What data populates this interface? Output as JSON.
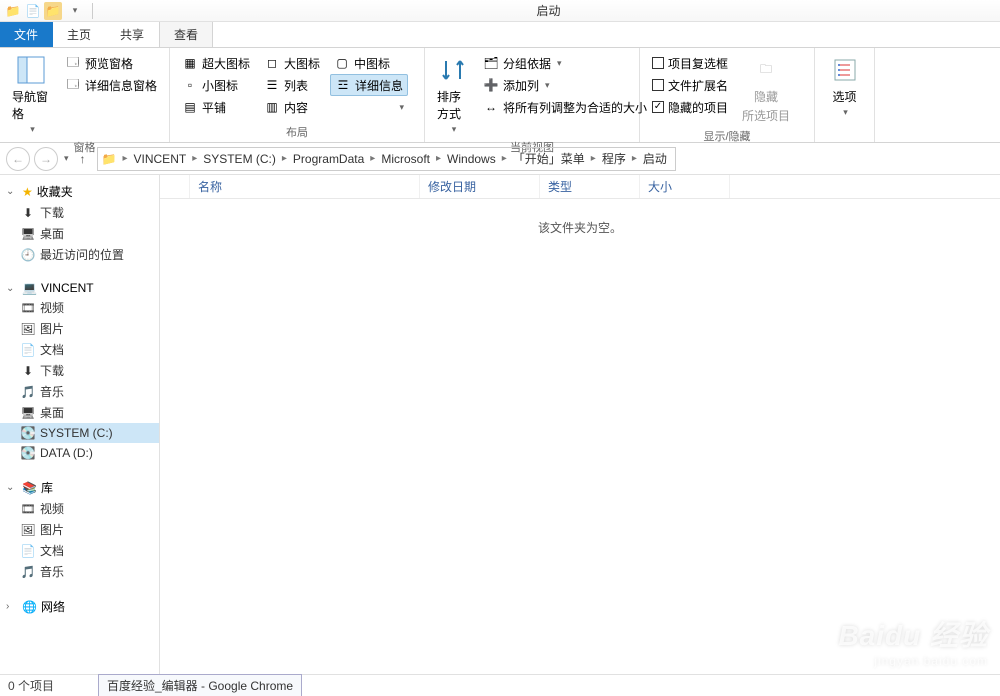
{
  "window": {
    "title": "启动"
  },
  "tabs": {
    "file": "文件",
    "home": "主页",
    "share": "共享",
    "view": "查看"
  },
  "ribbon": {
    "panes": {
      "nav_pane": "导航窗格",
      "preview_pane": "预览窗格",
      "details_pane": "详细信息窗格",
      "group": "窗格"
    },
    "layout": {
      "xl_icons": "超大图标",
      "l_icons": "大图标",
      "m_icons": "中图标",
      "s_icons": "小图标",
      "list": "列表",
      "details": "详细信息",
      "tiles": "平铺",
      "content": "内容",
      "group": "布局"
    },
    "view": {
      "sort": "排序方式",
      "group_by": "分组依据",
      "add_cols": "添加列",
      "fit_cols": "将所有列调整为合适的大小",
      "group": "当前视图"
    },
    "showhide": {
      "checkboxes": "项目复选框",
      "extensions": "文件扩展名",
      "hidden": "隐藏的项目",
      "hide": "隐藏",
      "selected": "所选项目",
      "group": "显示/隐藏"
    },
    "options": {
      "label": "选项"
    }
  },
  "breadcrumb": [
    "VINCENT",
    "SYSTEM (C:)",
    "ProgramData",
    "Microsoft",
    "Windows",
    "「开始」菜单",
    "程序",
    "启动"
  ],
  "sidebar": {
    "fav": {
      "label": "收藏夹",
      "items": [
        "下载",
        "桌面",
        "最近访问的位置"
      ]
    },
    "pc": {
      "label": "VINCENT",
      "items": [
        "视频",
        "图片",
        "文档",
        "下载",
        "音乐",
        "桌面",
        "SYSTEM (C:)",
        "DATA (D:)"
      ]
    },
    "lib": {
      "label": "库",
      "items": [
        "视频",
        "图片",
        "文档",
        "音乐"
      ]
    },
    "net": {
      "label": "网络"
    }
  },
  "columns": {
    "name": "名称",
    "date": "修改日期",
    "type": "类型",
    "size": "大小"
  },
  "content": {
    "empty": "该文件夹为空。"
  },
  "status": {
    "items": "0 个项目"
  },
  "taskbar": {
    "chrome": "百度经验_编辑器 - Google Chrome"
  },
  "watermark": {
    "brand": "Baidu 经验",
    "url": "jingyan.baidu.com"
  },
  "icons": {
    "folder": "📁",
    "down": "⬇",
    "desktop": "🖥",
    "recent": "🕘",
    "pc": "💻",
    "video": "🎞",
    "pic": "🖼",
    "doc": "📄",
    "music": "🎵",
    "drive": "💽",
    "lib": "📚",
    "net": "🌐",
    "star": "★"
  }
}
